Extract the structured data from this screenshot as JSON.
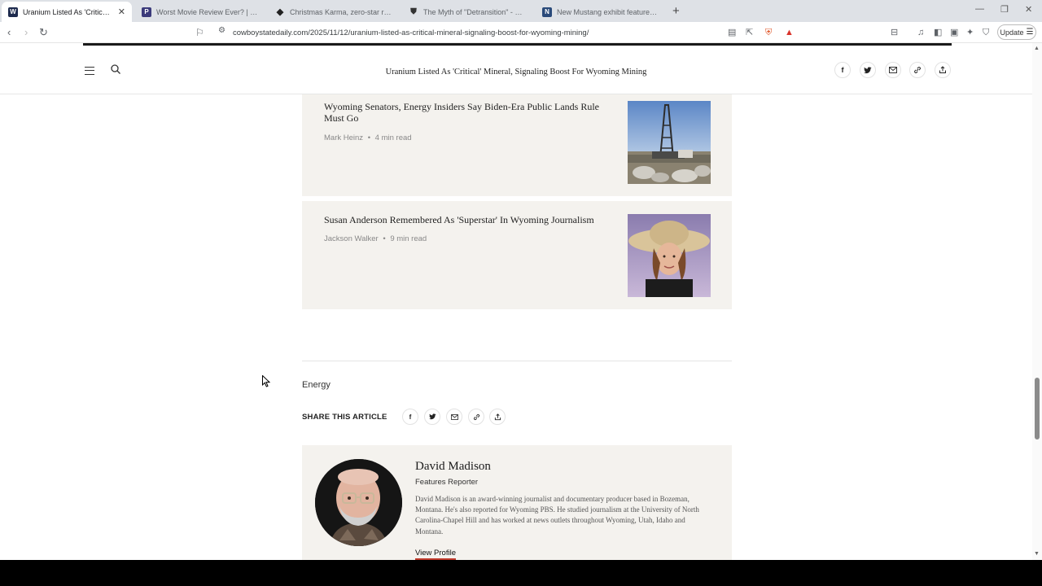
{
  "browser": {
    "tabs": [
      {
        "title": "Uranium Listed As 'Critical' Mine",
        "active": true,
        "favicon_color": "#1e2b4e",
        "favicon": "W"
      },
      {
        "title": "Worst Movie Review Ever? | Power Li",
        "active": false,
        "favicon_color": "#3b3a7a",
        "favicon": "PL"
      },
      {
        "title": "Christmas Karma, zero-star review: Th",
        "active": false,
        "favicon_color": "#222222",
        "favicon": "◆"
      },
      {
        "title": "The Myth of \"Detransition\" - by KB an",
        "active": false,
        "favicon_color": "#333333",
        "favicon": "▮"
      },
      {
        "title": "New Mustang exhibit features Hollyw",
        "active": false,
        "favicon_color": "#2a4a7a",
        "favicon": "N"
      }
    ],
    "url": "cowboystatedaily.com/2025/11/12/uranium-listed-as-critical-mineral-signaling-boost-for-wyoming-mining/",
    "update_label": "Update"
  },
  "header": {
    "title": "Uranium Listed As 'Critical' Mineral, Signaling Boost For Wyoming Mining",
    "share_icons": [
      "facebook-icon",
      "twitter-icon",
      "mail-icon",
      "link-icon",
      "share-icon"
    ]
  },
  "related": [
    {
      "title": "Wyoming Senators, Energy Insiders Say Biden-Era Public Lands Rule Must Go",
      "author": "Mark Heinz",
      "read_time": "4 min read"
    },
    {
      "title": "Susan Anderson Remembered As 'Superstar' In Wyoming Journalism",
      "author": "Jackson Walker",
      "read_time": "9 min read"
    }
  ],
  "meta_separator": "•",
  "category": "Energy",
  "share": {
    "label": "SHARE THIS ARTICLE"
  },
  "author": {
    "name": "David Madison",
    "role": "Features Reporter",
    "bio": "David Madison is an award-winning journalist and documentary producer based in Bozeman, Montana. He's also reported for Wyoming PBS. He studied journalism at the University of North Carolina-Chapel Hill and has worked at news outlets throughout Wyoming, Utah, Idaho and Montana.",
    "link_label": "View Profile"
  }
}
